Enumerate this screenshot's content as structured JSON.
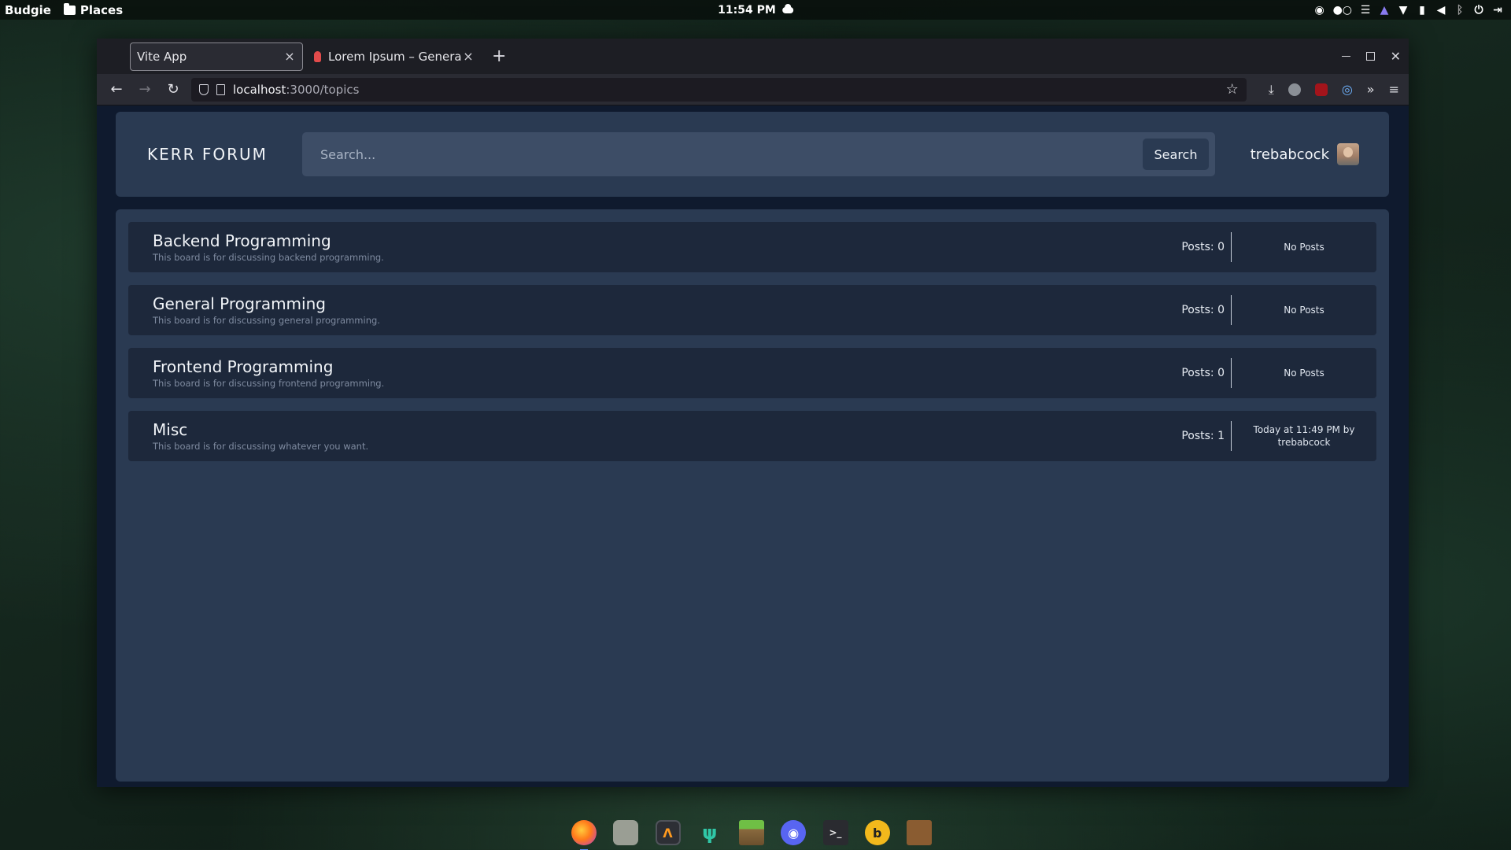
{
  "top_panel": {
    "menu_label": "Budgie",
    "places_label": "Places",
    "clock": "11:54 PM",
    "tray_icons": [
      "discord-tray-icon",
      "pager-dots-icon",
      "menu-lines-icon",
      "notification-bell-icon",
      "wifi-icon",
      "battery-icon",
      "volume-icon",
      "bluetooth-icon",
      "power-icon",
      "logout-icon"
    ]
  },
  "browser": {
    "tabs": [
      {
        "label": "Vite App",
        "active": true
      },
      {
        "label": "Lorem Ipsum – Generat",
        "active": false
      }
    ],
    "new_tab_label": "+",
    "url_host": "localhost",
    "url_path": ":3000/topics"
  },
  "app": {
    "brand": "KERR FORUM",
    "search": {
      "placeholder": "Search...",
      "button_label": "Search"
    },
    "username": "trebabcock",
    "boards": [
      {
        "title": "Backend Programming",
        "description": "This board is for discussing backend programming.",
        "posts": "Posts: 0",
        "last_post": "No Posts"
      },
      {
        "title": "General Programming",
        "description": "This board is for discussing general programming.",
        "posts": "Posts: 0",
        "last_post": "No Posts"
      },
      {
        "title": "Frontend Programming",
        "description": "This board is for discussing frontend programming.",
        "posts": "Posts: 0",
        "last_post": "No Posts"
      },
      {
        "title": "Misc",
        "description": "This board is for discussing whatever you want.",
        "posts": "Posts: 1",
        "last_post": "Today at 11:49 PM by trebabcock"
      }
    ]
  },
  "dock": {
    "items": [
      "firefox-icon",
      "files-icon",
      "sublime-text-icon",
      "git-client-icon",
      "minecraft-grass-icon",
      "discord-icon",
      "terminal-icon",
      "bolt-app-icon",
      "crate-app-icon"
    ]
  },
  "colors": {
    "header_card": "#2a3a52",
    "board_row": "#1d283b",
    "page_bg": "#0f1a2e",
    "search_field": "#3d4d66"
  }
}
